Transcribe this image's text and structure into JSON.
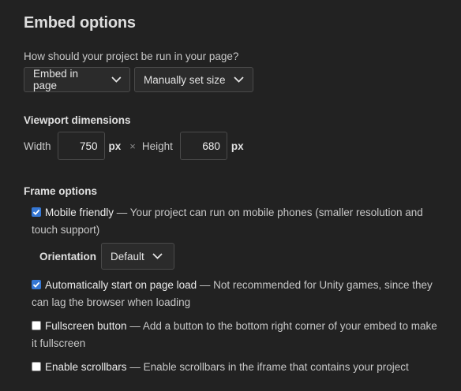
{
  "title": "Embed options",
  "question": "How should your project be run in your page?",
  "embed_mode": {
    "value": "Embed in page",
    "options": [
      "Embed in page"
    ]
  },
  "size_mode": {
    "value": "Manually set size",
    "options": [
      "Manually set size"
    ]
  },
  "viewport": {
    "heading": "Viewport dimensions",
    "width_label": "Width",
    "width_value": "750",
    "height_label": "Height",
    "height_value": "680",
    "unit": "px",
    "separator": "×"
  },
  "frame": {
    "heading": "Frame options",
    "mobile": {
      "checked": true,
      "name": "Mobile friendly",
      "desc": " — Your project can run on mobile phones (smaller resolution and touch support)"
    },
    "orientation": {
      "label": "Orientation",
      "value": "Default"
    },
    "autostart": {
      "checked": true,
      "name": "Automatically start on page load",
      "desc": " — Not recommended for Unity games, since they can lag the browser when loading"
    },
    "fullscreen": {
      "checked": false,
      "name": "Fullscreen button",
      "desc": " — Add a button to the bottom right corner of your embed to make it fullscreen"
    },
    "scrollbars": {
      "checked": false,
      "name": "Enable scrollbars",
      "desc": " — Enable scrollbars in the iframe that contains your project"
    }
  },
  "colors": {
    "background": "#222222",
    "checkbox_on": "#3577d4",
    "border": "#4a4a4a"
  },
  "icons": {
    "dropdown": "chevron-down-icon",
    "check": "check-icon"
  }
}
